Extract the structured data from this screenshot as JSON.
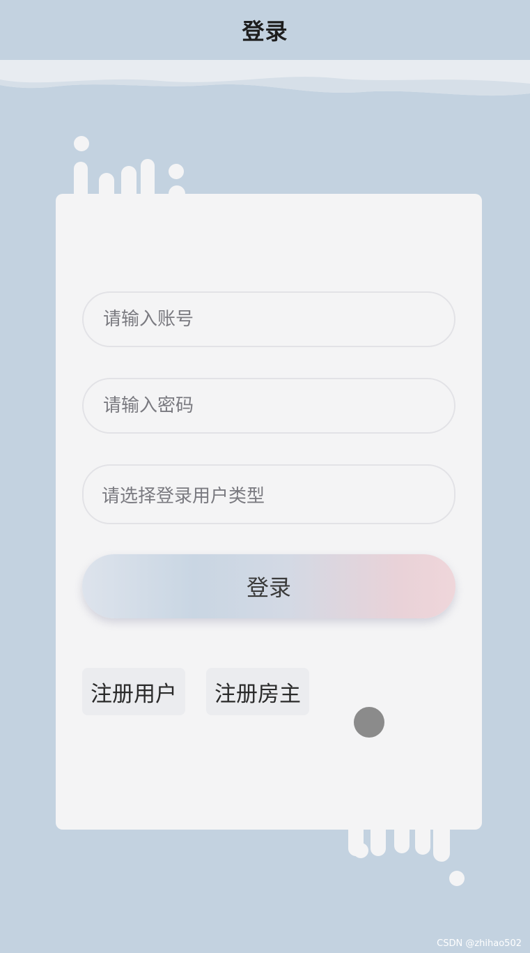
{
  "header": {
    "title": "登录"
  },
  "form": {
    "account_placeholder": "请输入账号",
    "password_placeholder": "请输入密码",
    "user_type_placeholder": "请选择登录用户类型",
    "login_label": "登录"
  },
  "links": {
    "register_user": "注册用户",
    "register_owner": "注册房主"
  },
  "watermark": "CSDN @zhihao502",
  "colors": {
    "background": "#c3d2e0",
    "card": "#f4f4f5",
    "button_gradient_start": "#c9d6e3",
    "button_gradient_end": "#efd6da"
  }
}
